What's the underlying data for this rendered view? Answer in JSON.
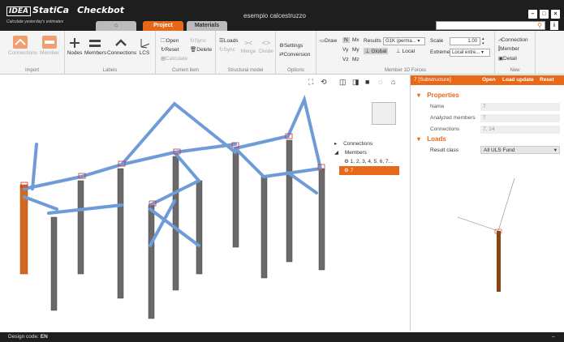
{
  "app": {
    "brand": "IDEA",
    "product": "StatiCa",
    "module": "Checkbot",
    "tagline": "Calculate yesterday's estimates",
    "document_title": "esempio calcestruzzo"
  },
  "tabs": [
    {
      "label": ""
    },
    {
      "label": "Project"
    },
    {
      "label": "Materials"
    }
  ],
  "ribbon": {
    "import": {
      "label": "Import",
      "connections": "Connections",
      "member": "Member"
    },
    "labels": {
      "label": "Labels",
      "nodes": "Nodes",
      "members": "Members",
      "connections": "Connections",
      "lcs": "LCS"
    },
    "current_item": {
      "label": "Current item",
      "open": "Open",
      "reset": "Reset",
      "calculate": "Calculate",
      "sync": "Sync",
      "delete": "Delete"
    },
    "structural_model": {
      "label": "Structural model",
      "loads": "Loads",
      "sync": "Sync",
      "merge": "Merge",
      "divide": "Divide"
    },
    "options": {
      "label": "Options",
      "settings": "Settings",
      "conversion": "Conversion"
    },
    "forces": {
      "label": "Member 1D Forces",
      "draw": "Draw",
      "n": "N",
      "mx": "Mx",
      "vy": "Vy",
      "my": "My",
      "vz": "Vz",
      "mz": "Mz",
      "results_label": "Results",
      "results_value": "G1K (perma...",
      "global": "Global",
      "local": "Local",
      "scale_label": "Scale",
      "scale_value": "1.00",
      "extreme_label": "Extreme",
      "extreme_value": "Local extre..."
    },
    "new": {
      "label": "New",
      "connection": "Connection",
      "member": "Member",
      "detail": "Detail"
    }
  },
  "tree": {
    "connections": "Connections",
    "members": "Members",
    "member_list": "1, 2, 3, 4, 5, 6, 7...",
    "selected": "7"
  },
  "panel": {
    "title": "7  [Substructure]",
    "open": "Open",
    "load_update": "Load update",
    "reset": "Reset",
    "properties": "Properties",
    "name_label": "Name",
    "name_value": "7",
    "analyzed_label": "Analyzed members",
    "analyzed_value": "7",
    "connections_label": "Connections",
    "connections_value": "7, 14",
    "loads": "Loads",
    "result_class_label": "Result class",
    "result_class_value": "All ULS Fund"
  },
  "status": {
    "label": "Design code:",
    "value": "EN"
  },
  "colors": {
    "accent": "#e8681a",
    "titlebar": "#1e1e1e"
  }
}
